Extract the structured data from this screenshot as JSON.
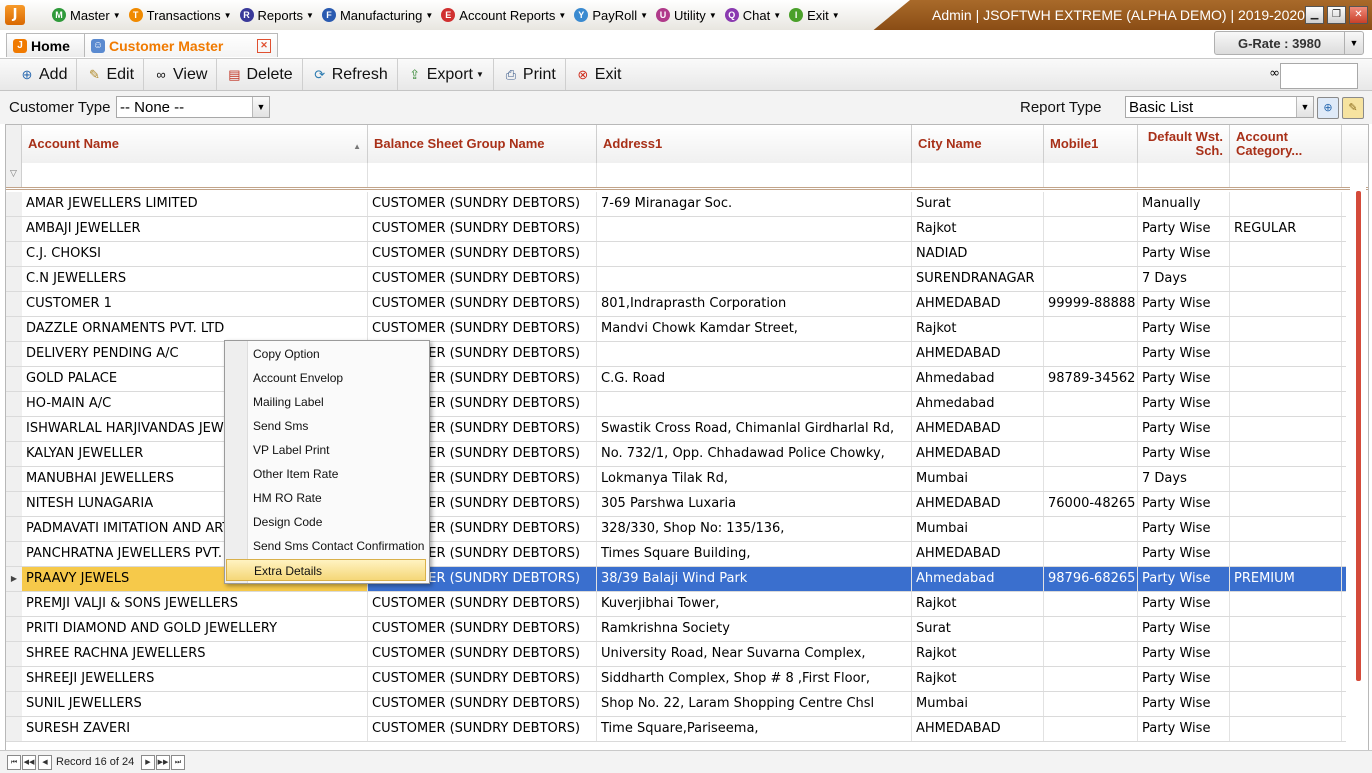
{
  "menu": {
    "logo": "J",
    "items": [
      {
        "label": "Master",
        "icon": "M",
        "color": "#2f9a3a"
      },
      {
        "label": "Transactions",
        "icon": "T",
        "color": "#f08a00"
      },
      {
        "label": "Reports",
        "icon": "R",
        "color": "#3a3a9a"
      },
      {
        "label": "Manufacturing",
        "icon": "F",
        "color": "#2a5ab0"
      },
      {
        "label": "Account Reports",
        "icon": "E",
        "color": "#d03030"
      },
      {
        "label": "PayRoll",
        "icon": "Y",
        "color": "#3a8ad0"
      },
      {
        "label": "Utility",
        "icon": "U",
        "color": "#b03a8a"
      },
      {
        "label": "Chat",
        "icon": "Q",
        "color": "#8a3ab0"
      },
      {
        "label": "Exit",
        "icon": "I",
        "color": "#4aa02a"
      }
    ]
  },
  "app_title": "Admin | JSOFTWH EXTREME (ALPHA DEMO)  | 2019-2020",
  "tabs": {
    "home": "Home",
    "customer": "Customer Master"
  },
  "grate": "G-Rate : 3980",
  "toolbar": {
    "add": "Add",
    "edit": "Edit",
    "view": "View",
    "delete": "Delete",
    "refresh": "Refresh",
    "export": "Export",
    "print": "Print",
    "exit": "Exit"
  },
  "filter": {
    "customer_type_label": "Customer Type",
    "customer_type_value": "-- None --",
    "report_type_label": "Report Type",
    "report_type_value": "Basic List"
  },
  "grid": {
    "columns": [
      "Account Name",
      "Balance Sheet Group Name",
      "Address1",
      "City Name",
      "Mobile1",
      "Default Wst. Sch.",
      "Account Category..."
    ],
    "rows": [
      [
        "AMAR JEWELLERS LIMITED",
        "CUSTOMER (SUNDRY DEBTORS)",
        "7-69 Miranagar Soc.",
        "Surat",
        "",
        "Manually",
        ""
      ],
      [
        "AMBAJI JEWELLER",
        "CUSTOMER (SUNDRY DEBTORS)",
        "",
        "Rajkot",
        "",
        "Party Wise",
        "REGULAR"
      ],
      [
        "C.J. CHOKSI",
        "CUSTOMER (SUNDRY DEBTORS)",
        "",
        "NADIAD",
        "",
        "Party Wise",
        ""
      ],
      [
        "C.N JEWELLERS",
        "CUSTOMER (SUNDRY DEBTORS)",
        "",
        "SURENDRANAGAR",
        "",
        "7 Days",
        ""
      ],
      [
        "CUSTOMER 1",
        "CUSTOMER (SUNDRY DEBTORS)",
        "801,Indraprasth Corporation",
        "AHMEDABAD",
        "99999-88888",
        "Party Wise",
        ""
      ],
      [
        "DAZZLE ORNAMENTS PVT. LTD",
        "CUSTOMER (SUNDRY DEBTORS)",
        "Mandvi Chowk Kamdar Street,",
        "Rajkot",
        "",
        "Party Wise",
        ""
      ],
      [
        "DELIVERY PENDING A/C",
        "CUSTOMER (SUNDRY DEBTORS)",
        "",
        "AHMEDABAD",
        "",
        "Party Wise",
        ""
      ],
      [
        "GOLD PALACE",
        "CUSTOMER (SUNDRY DEBTORS)",
        "C.G. Road",
        "Ahmedabad",
        "98789-34562",
        "Party Wise",
        ""
      ],
      [
        "HO-MAIN A/C",
        "CUSTOMER (SUNDRY DEBTORS)",
        "",
        "Ahmedabad",
        "",
        "Party Wise",
        ""
      ],
      [
        "ISHWARLAL HARJIVANDAS JEWELLERS",
        "CUSTOMER (SUNDRY DEBTORS)",
        "Swastik Cross Road, Chimanlal Girdharlal Rd,",
        "AHMEDABAD",
        "",
        "Party Wise",
        ""
      ],
      [
        "KALYAN JEWELLER",
        "CUSTOMER (SUNDRY DEBTORS)",
        "No. 732/1, Opp. Chhadawad Police Chowky,",
        "AHMEDABAD",
        "",
        "Party Wise",
        ""
      ],
      [
        "MANUBHAI JEWELLERS",
        "CUSTOMER (SUNDRY DEBTORS)",
        "Lokmanya Tilak Rd,",
        "Mumbai",
        "",
        "7 Days",
        ""
      ],
      [
        "NITESH LUNAGARIA",
        "CUSTOMER (SUNDRY DEBTORS)",
        "305 Parshwa Luxaria",
        "AHMEDABAD",
        "76000-48265",
        "Party Wise",
        ""
      ],
      [
        "PADMAVATI IMITATION AND ARTIFICIAL",
        "CUSTOMER (SUNDRY DEBTORS)",
        "328/330, Shop No: 135/136,",
        "Mumbai",
        "",
        "Party Wise",
        ""
      ],
      [
        "PANCHRATNA JEWELLERS PVT. LTD",
        "CUSTOMER (SUNDRY DEBTORS)",
        "Times Square Building,",
        "AHMEDABAD",
        "",
        "Party Wise",
        ""
      ],
      [
        "PRAAVY JEWELS",
        "CUSTOMER (SUNDRY DEBTORS)",
        "38/39 Balaji Wind Park",
        "Ahmedabad",
        "98796-68265",
        "Party Wise",
        "PREMIUM"
      ],
      [
        "PREMJI VALJI & SONS JEWELLERS",
        "CUSTOMER (SUNDRY DEBTORS)",
        "Kuverjibhai Tower,",
        "Rajkot",
        "",
        "Party Wise",
        ""
      ],
      [
        "PRITI DIAMOND AND GOLD JEWELLERY",
        "CUSTOMER (SUNDRY DEBTORS)",
        "Ramkrishna Society",
        "Surat",
        "",
        "Party Wise",
        ""
      ],
      [
        "SHREE RACHNA JEWELLERS",
        "CUSTOMER (SUNDRY DEBTORS)",
        "University Road, Near Suvarna Complex,",
        "Rajkot",
        "",
        "Party Wise",
        ""
      ],
      [
        "SHREEJI JEWELLERS",
        "CUSTOMER (SUNDRY DEBTORS)",
        "Siddharth Complex, Shop # 8 ,First Floor,",
        "Rajkot",
        "",
        "Party Wise",
        ""
      ],
      [
        "SUNIL JEWELLERS",
        "CUSTOMER (SUNDRY DEBTORS)",
        "Shop No. 22, Laram Shopping Centre Chsl",
        "Mumbai",
        "",
        "Party Wise",
        ""
      ],
      [
        "SURESH ZAVERI",
        "CUSTOMER (SUNDRY DEBTORS)",
        "Time Square,Pariseema,",
        "AHMEDABAD",
        "",
        "Party Wise",
        ""
      ]
    ],
    "selected_row": 15
  },
  "context_menu": {
    "items": [
      "Copy Option",
      "Account Envelop",
      "Mailing Label",
      "Send Sms",
      "VP Label Print",
      "Other Item Rate",
      "HM RO Rate",
      "Design Code",
      "Send Sms Contact Confirmation",
      "Extra Details"
    ],
    "highlighted": 9
  },
  "status": {
    "record_text": "Record 16 of 24"
  },
  "colors": {
    "header_text": "#a83018",
    "selected_row": "#3a6fce",
    "selected_cell": "#f6c94a",
    "accent": "#f07a00"
  }
}
